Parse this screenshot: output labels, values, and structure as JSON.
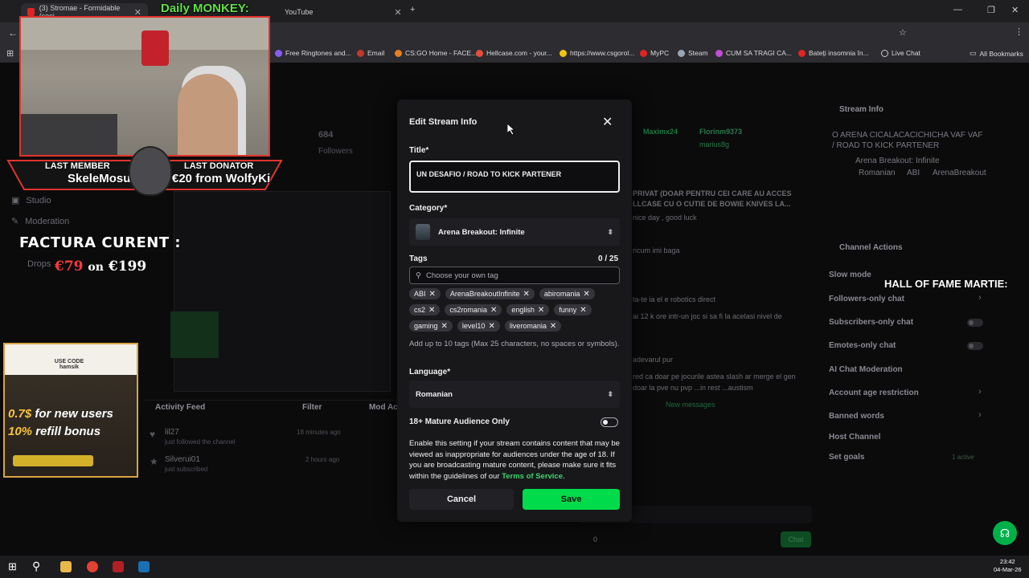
{
  "browser": {
    "tabs": [
      {
        "label": "(3) Stromae - Formidable (ceci",
        "active": true
      },
      {
        "label": "Daily MONKEY:",
        "active": false
      },
      {
        "label": "YouTube",
        "active": false
      }
    ],
    "bookmarks": [
      "Free Ringtones and...",
      "Email",
      "CS:GO Home - FACE...",
      "Hellcase.com - your...",
      "https://www.csgorol...",
      "MyPC",
      "Steam",
      "CUM SA TRAGI CA...",
      "Bateți insomnia în...",
      "Live Chat",
      "All Bookmarks"
    ]
  },
  "overlay": {
    "last_member_label": "LAST MEMBER",
    "last_member_name": "SkeleMosu",
    "last_donator_label": "LAST DONATOR",
    "last_donator_value": "€20 from WolfyKi",
    "factura_label": "FACTURA CURENT :",
    "factura_current": "€79",
    "factura_on": "on",
    "factura_total": "€199",
    "hall_of_fame": "HALL OF FAME MARTIE:",
    "ad_use_code": "USE CODE",
    "ad_code": "hamsik",
    "ad_line1_value": "0.7$",
    "ad_line1_text": "for new users",
    "ad_line2_value": "10%",
    "ad_line2_text": "refill bonus"
  },
  "dashboard": {
    "followers_count": "684",
    "followers_label": "Followers",
    "sidebar": [
      "Studio",
      "Moderation",
      "Drops"
    ],
    "activity_feed": "Activity Feed",
    "filter": "Filter",
    "mod_actions": "Mod Ac",
    "activity": [
      {
        "name": "lil27",
        "text": "just followed the channel",
        "time": "18 minutes ago"
      },
      {
        "name": "Silverui01",
        "text": "just subscribed",
        "time": "2 hours ago"
      }
    ],
    "stream_info_title": "Stream Info",
    "stream_info_text": "O ARENA CICALACACICHICHA VAF VAF / ROAD TO KICK PARTENER",
    "stream_info_game": "Arena Breakout: Infinite",
    "stream_info_tags": [
      "Romanian",
      "ABI",
      "ArenaBreakout"
    ],
    "channel_actions_title": "Channel Actions",
    "channel_actions": [
      "Slow mode",
      "Followers-only chat",
      "Subscribers-only chat",
      "Emotes-only chat",
      "AI Chat Moderation",
      "Account age restriction",
      "Banned words",
      "Host Channel",
      "Set goals"
    ],
    "chat_users": [
      "Maximx24",
      "Florinm9373",
      "marius8g"
    ],
    "chat_lines": [
      "PRIVAT (DOAR PENTRU CEI CARE AU ACCES",
      "LLCASE CU O CUTIE DE BOWIE KNIVES LA...",
      "nice day , good luck",
      "ricum imi baga",
      "ta-te ia el e robotics direct",
      "ai 12 k ore intr-un joc si sa fi la acelasi nivel de",
      "adevarul pur",
      "red ca doar pe jocurile astea slash ar merge el gen",
      "doar la pve nu pvp ...in rest ...austism"
    ],
    "new_messages": "New messages",
    "chat_button": "Chat",
    "chat_count": "0",
    "goal_status": "1 active"
  },
  "modal": {
    "title": "Edit Stream Info",
    "title_label": "Title*",
    "title_value": "UN DESAFIO / ROAD TO KICK PARTENER",
    "category_label": "Category*",
    "category_value": "Arena Breakout: Infinite",
    "tags_label": "Tags",
    "tags_count": "0 / 25",
    "tags_placeholder": "Choose your own tag",
    "tags": [
      "ABI",
      "ArenaBreakoutInfinite",
      "abiromania",
      "cs2",
      "cs2romania",
      "english",
      "funny",
      "gaming",
      "level10",
      "liveromania"
    ],
    "tags_help": "Add up to 10 tags (Max 25 characters, no spaces or symbols).",
    "language_label": "Language*",
    "language_value": "Romanian",
    "mature_label": "18+ Mature Audience Only",
    "mature_enabled": false,
    "mature_desc": "Enable this setting if your stream contains content that may be viewed as inappropriate for audiences under the age of 18. If you are broadcasting mature content, please make sure it fits within the guidelines of our",
    "tos_link": "Terms of Service",
    "tos_period": ".",
    "cancel_label": "Cancel",
    "save_label": "Save"
  },
  "taskbar": {
    "time": "23:42",
    "date": "04-Mar-26"
  },
  "colors": {
    "accent_green": "#00db4b",
    "link_green": "#3fd36d",
    "overlay_red": "#e0342c"
  }
}
